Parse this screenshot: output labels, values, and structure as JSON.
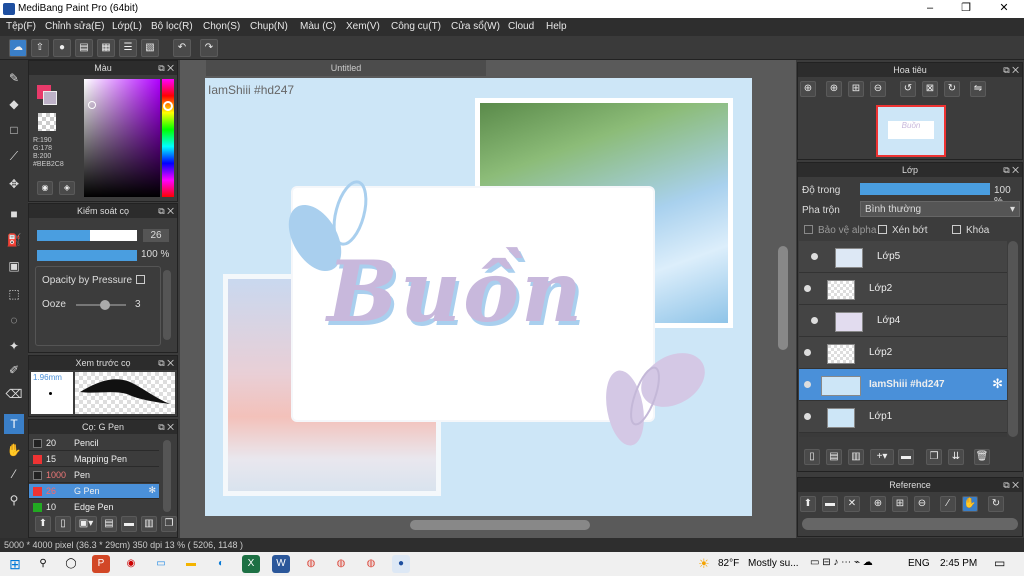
{
  "window": {
    "title": "MediBang Paint Pro (64bit)",
    "min": "–",
    "max": "❐",
    "close": "✕"
  },
  "menu": [
    "Tệp(F)",
    "Chỉnh sửa(E)",
    "Lớp(L)",
    "Bộ lọc(R)",
    "Chọn(S)",
    "Chụp(N)",
    "Màu (C)",
    "Xem(V)",
    "Công cụ(T)",
    "Cửa sổ(W)",
    "Cloud",
    "Help"
  ],
  "color_panel": {
    "title": "Màu",
    "rgb": "R:190\nG:178\nB:200\n#BEB2C8",
    "r": "R:190",
    "g": "G:178",
    "b": "B:200",
    "hex": "#BEB2C8",
    "fg": "#BEB2C8"
  },
  "brush_control": {
    "title": "Kiểm soát cọ",
    "size": "26",
    "opacity": "100 %",
    "opacity_pressure": "Opacity by Pressure",
    "ooze": "Ooze",
    "ooze_val": "3"
  },
  "brush_preview": {
    "title": "Xem trước cọ",
    "size": "1.96mm"
  },
  "brush_list": {
    "title": "Cọ: G Pen",
    "items": [
      {
        "size": "20",
        "name": "Pencil",
        "color": "#222"
      },
      {
        "size": "15",
        "name": "Mapping Pen",
        "color": "#e33"
      },
      {
        "size": "1000",
        "name": "Pen",
        "color": "#222"
      },
      {
        "size": "26",
        "name": "G Pen",
        "color": "#e33"
      },
      {
        "size": "10",
        "name": "Edge Pen",
        "color": "#2a2"
      }
    ]
  },
  "canvas": {
    "tab": "Untitled",
    "watermark": "IamShiii #hd247",
    "art_text": "Buồn"
  },
  "navigator": {
    "title": "Hoa tiêu"
  },
  "layers": {
    "title": "Lớp",
    "opacity_label": "Độ trong",
    "opacity_value": "100 %",
    "blend_label": "Pha trộn",
    "blend_value": "Bình thường",
    "protect_alpha": "Bảo vệ alpha",
    "clipping": "Xén bớt",
    "lock": "Khóa",
    "items": [
      {
        "name": "Lớp5"
      },
      {
        "name": "Lớp2"
      },
      {
        "name": "Lớp4"
      },
      {
        "name": "Lớp2"
      },
      {
        "name": "IamShiii #hd247"
      },
      {
        "name": "Lớp1"
      }
    ]
  },
  "reference": {
    "title": "Reference"
  },
  "status": "5000 * 4000 pixel  (36.3 * 29cm)  350 dpi  13 %  ( 5206, 1148 )",
  "taskbar": {
    "weather_temp": "82°F",
    "weather_text": "Mostly su...",
    "lang": "ENG",
    "time": "2:45 PM"
  }
}
